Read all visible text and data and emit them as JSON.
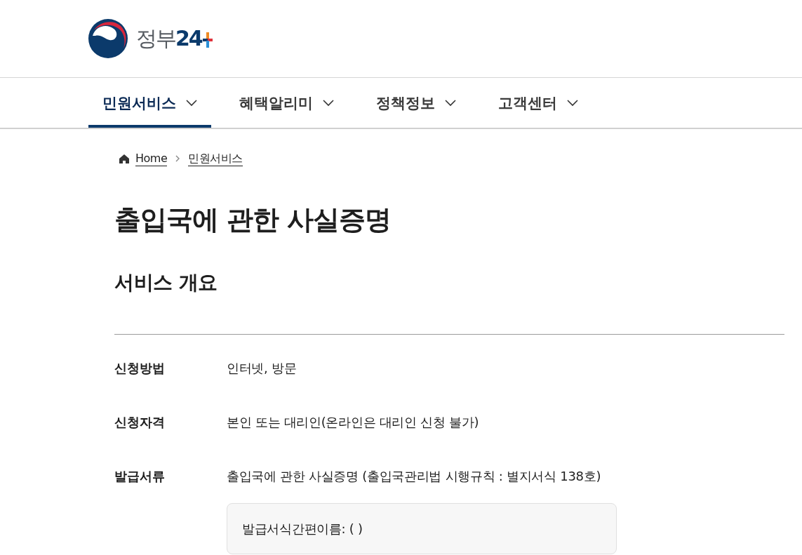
{
  "header": {
    "logo_text_parts": [
      "정부",
      "24"
    ]
  },
  "nav": [
    {
      "label": "민원서비스",
      "selected": true
    },
    {
      "label": "혜택알리미",
      "selected": false
    },
    {
      "label": "정책정보",
      "selected": false
    },
    {
      "label": "고객센터",
      "selected": false
    }
  ],
  "breadcrumb": [
    {
      "kind": "home",
      "label": "Home"
    },
    {
      "kind": "link",
      "label": "민원서비스"
    }
  ],
  "title": "출입국에 관한 사실증명",
  "section_title": "서비스 개요",
  "details": [
    {
      "label": "신청방법",
      "value": "인터넷, 방문"
    },
    {
      "label": "신청자격",
      "value": "본인 또는 대리인(온라인은 대리인 신청 불가)"
    },
    {
      "label": "발급서류",
      "value": "출입국에 관한 사실증명 (출입국관리법 시행규칙 : 별지서식 138호)",
      "note": "발급서식간편이름: ( )"
    }
  ]
}
